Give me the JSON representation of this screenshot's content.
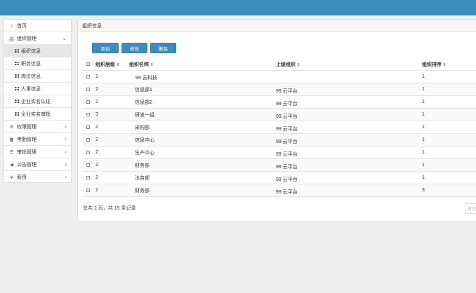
{
  "sidebar": {
    "items": [
      {
        "label": "首页",
        "icon": "home-icon"
      },
      {
        "label": "组织管理",
        "icon": "sitemap-icon"
      },
      {
        "label": "组织信息",
        "icon": "grid-icon"
      },
      {
        "label": "职务信息",
        "icon": "grid-icon"
      },
      {
        "label": "岗位信息",
        "icon": "grid-icon"
      },
      {
        "label": "人事信息",
        "icon": "grid-icon"
      },
      {
        "label": "企业实名认证",
        "icon": "grid-icon"
      },
      {
        "label": "企业实名审批",
        "icon": "grid-icon"
      },
      {
        "label": "权限管理",
        "icon": "cogs-icon"
      },
      {
        "label": "考勤管理",
        "icon": "calendar-icon"
      },
      {
        "label": "审批管理",
        "icon": "list-icon"
      },
      {
        "label": "公告管理",
        "icon": "bullhorn-icon"
      },
      {
        "label": "薪资",
        "icon": "yen-icon"
      }
    ]
  },
  "main": {
    "title": "组织信息",
    "buttons": {
      "add": "添加",
      "edit": "修改",
      "delete": "删除"
    },
    "columns": {
      "level": "组织层级",
      "name": "组织名称",
      "parent": "上级组织",
      "order": "组织排序"
    },
    "sort_glyph": "⇕",
    "rows": [
      {
        "level": "1",
        "name": "99 云科技",
        "parent": "",
        "order": "1"
      },
      {
        "level": "2",
        "name": "信息部1",
        "parent": "99 云平台",
        "order": "1"
      },
      {
        "level": "2",
        "name": "信息部2",
        "parent": "99 云平台",
        "order": "1"
      },
      {
        "level": "3",
        "name": "研发一组",
        "parent": "99 云平台",
        "order": "1"
      },
      {
        "level": "2",
        "name": "采购部",
        "parent": "99 云平台",
        "order": "1"
      },
      {
        "level": "2",
        "name": "信息中心",
        "parent": "99 云平台",
        "order": "1"
      },
      {
        "level": "2",
        "name": "生产中心",
        "parent": "99 云平台",
        "order": "1"
      },
      {
        "level": "2",
        "name": "财务部",
        "parent": "99 云平台",
        "order": "1"
      },
      {
        "level": "2",
        "name": "法务部",
        "parent": "99 云平台",
        "order": "1"
      },
      {
        "level": "2",
        "name": "财务部",
        "parent": "99 云平台",
        "order": "3"
      }
    ],
    "footer": "总共 2 页，共 15 条记录",
    "pager_label": "首页"
  },
  "colors": {
    "topbar": "#3c8dbc",
    "button": "#3c8dbc"
  }
}
